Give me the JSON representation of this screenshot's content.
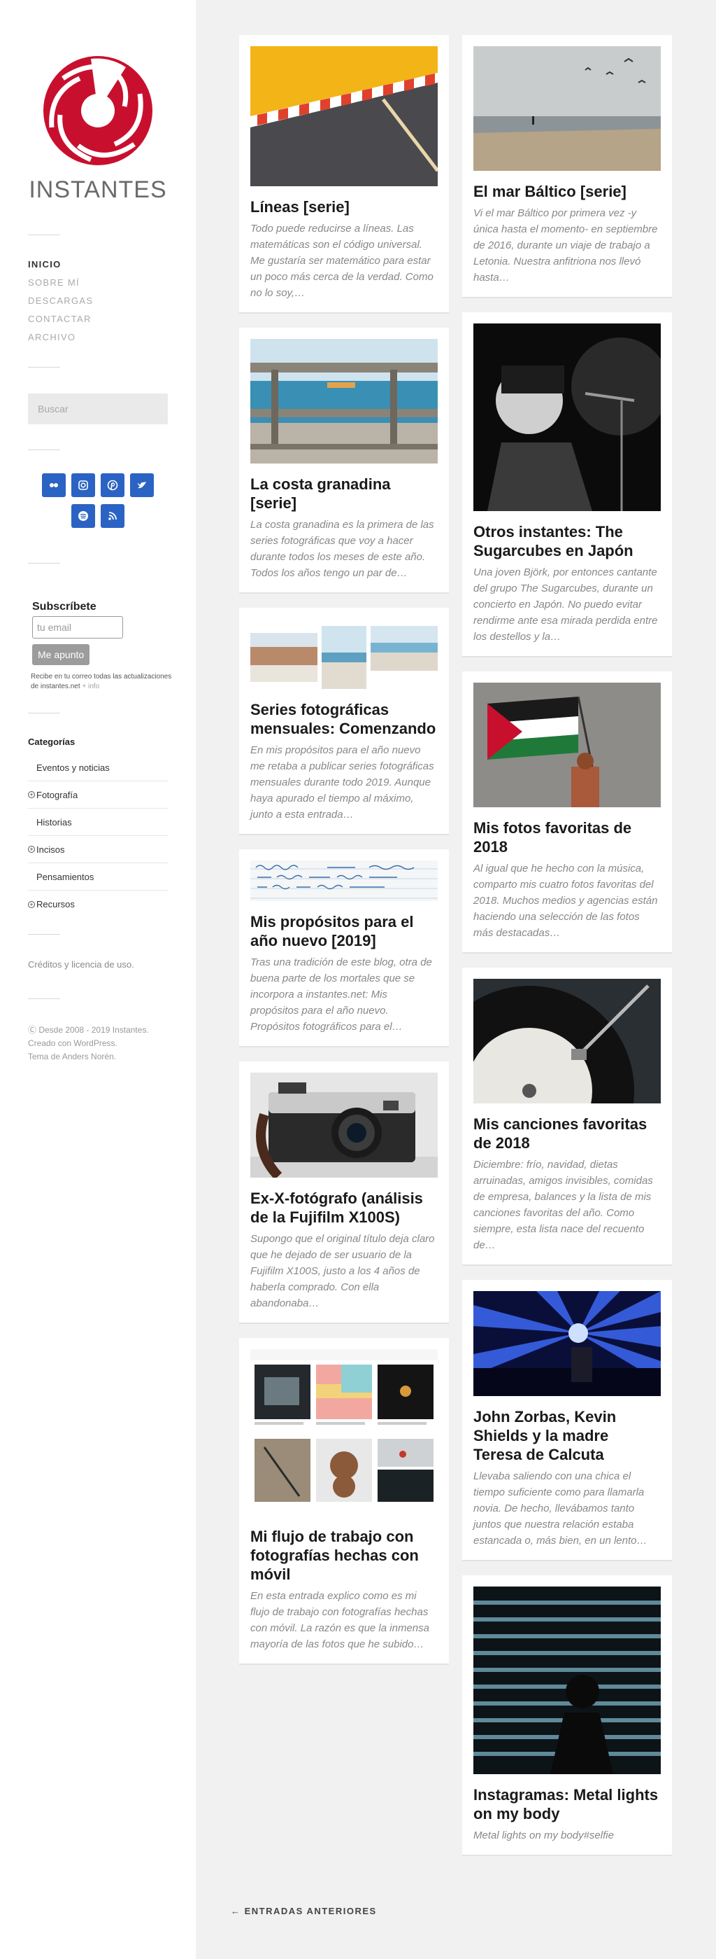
{
  "site": {
    "title": "INSTANTES",
    "brand_color": "#c8102e"
  },
  "nav": [
    "INICIO",
    "SOBRE MÍ",
    "DESCARGAS",
    "CONTACTAR",
    "ARCHIVO"
  ],
  "search": {
    "placeholder": "Buscar"
  },
  "social": [
    "flickr-icon",
    "instagram-icon",
    "pinterest-icon",
    "twitter-icon",
    "spotify-icon",
    "rss-icon"
  ],
  "subscribe": {
    "title": "Subscríbete",
    "placeholder": "tu email",
    "button": "Me apunto",
    "note": "Recibe en tu correo todas las actualizaciones de instantes.net",
    "info": "+ info"
  },
  "categories": {
    "title": "Categorías",
    "items": [
      {
        "label": "Eventos y noticias",
        "expandable": false
      },
      {
        "label": "Fotografía",
        "expandable": true
      },
      {
        "label": "Historias",
        "expandable": false
      },
      {
        "label": "Incisos",
        "expandable": true
      },
      {
        "label": "Pensamientos",
        "expandable": false
      },
      {
        "label": "Recursos",
        "expandable": true
      }
    ]
  },
  "credits": "Créditos y licencia de uso.",
  "footer": {
    "line1": "Ⓒ Desde 2008 - 2019 Instantes.",
    "line2": "Creado con WordPress.",
    "line3": "Tema de Anders Norén."
  },
  "posts_left": [
    {
      "title": "Líneas [serie]",
      "excerpt": "Todo puede reducirse a líneas. Las matemáticas son el código universal. Me gustaría ser matemático para estar un poco más cerca de la verdad. Como no lo soy,…"
    },
    {
      "title": "La costa granadina [serie]",
      "excerpt": "La costa granadina es la primera de las series fotográficas que voy a hacer durante todos los meses de este año. Todos los años tengo un par de…"
    },
    {
      "title": "Series fotográficas mensuales: Comenzando",
      "excerpt": "En mis propósitos para el año nuevo me retaba a publicar series fotográficas mensuales durante todo 2019. Aunque haya apurado el tiempo al máximo, junto a esta entrada…"
    },
    {
      "title": "Mis propósitos para el año nuevo [2019]",
      "excerpt": "Tras una tradición de este blog, otra de buena parte de los mortales que se incorpora a instantes.net: Mis propósitos para el año nuevo. Propósitos fotográficos para el…"
    },
    {
      "title": "Ex-X-fotógrafo (análisis de la Fujifilm X100S)",
      "excerpt": "Supongo que el original título deja claro que he dejado de ser usuario de la Fujifilm X100S, justo a los 4 años de haberla comprado. Con ella abandonaba…"
    },
    {
      "title": "Mi flujo de trabajo con fotografías hechas con móvil",
      "excerpt": "En esta entrada explico como es mi flujo de trabajo con fotografías hechas con móvil. La razón es que la inmensa mayoría de las fotos que he subido…"
    }
  ],
  "posts_right": [
    {
      "title": "El mar Báltico [serie]",
      "excerpt": "Vi el mar Báltico por primera vez -y única hasta el momento- en septiembre de 2016, durante un viaje de trabajo a Letonia. Nuestra anfitriona nos llevó hasta…"
    },
    {
      "title": "Otros instantes: The Sugarcubes en Japón",
      "excerpt": "Una joven Björk, por entonces cantante del grupo  The Sugarcubes, durante un concierto en Japón. No puedo evitar rendirme ante esa mirada perdida entre los destellos y la…"
    },
    {
      "title": "Mis fotos favoritas de 2018",
      "excerpt": "Al igual que he hecho con la música, comparto mis cuatro fotos favoritas del 2018. Muchos medios y agencias están haciendo una selección de las fotos más destacadas…"
    },
    {
      "title": "Mis canciones favoritas de 2018",
      "excerpt": "Diciembre: frío, navidad, dietas arruinadas, amigos invisibles, comidas de empresa, balances y la lista de mis canciones favoritas del año. Como siempre, esta lista nace del recuento de…"
    },
    {
      "title": "John Zorbas, Kevin Shields y la madre Teresa de Calcuta",
      "excerpt": "Llevaba saliendo con una chica el tiempo suficiente como para llamarla novia. De hecho, llevábamos tanto juntos que nuestra relación estaba estancada o, más bien, en un lento…"
    },
    {
      "title": "Instagramas: Metal lights on my body",
      "excerpt": "Metal lights on my body#selfie"
    }
  ],
  "pagination": {
    "previous": "← ENTRADAS ANTERIORES"
  }
}
